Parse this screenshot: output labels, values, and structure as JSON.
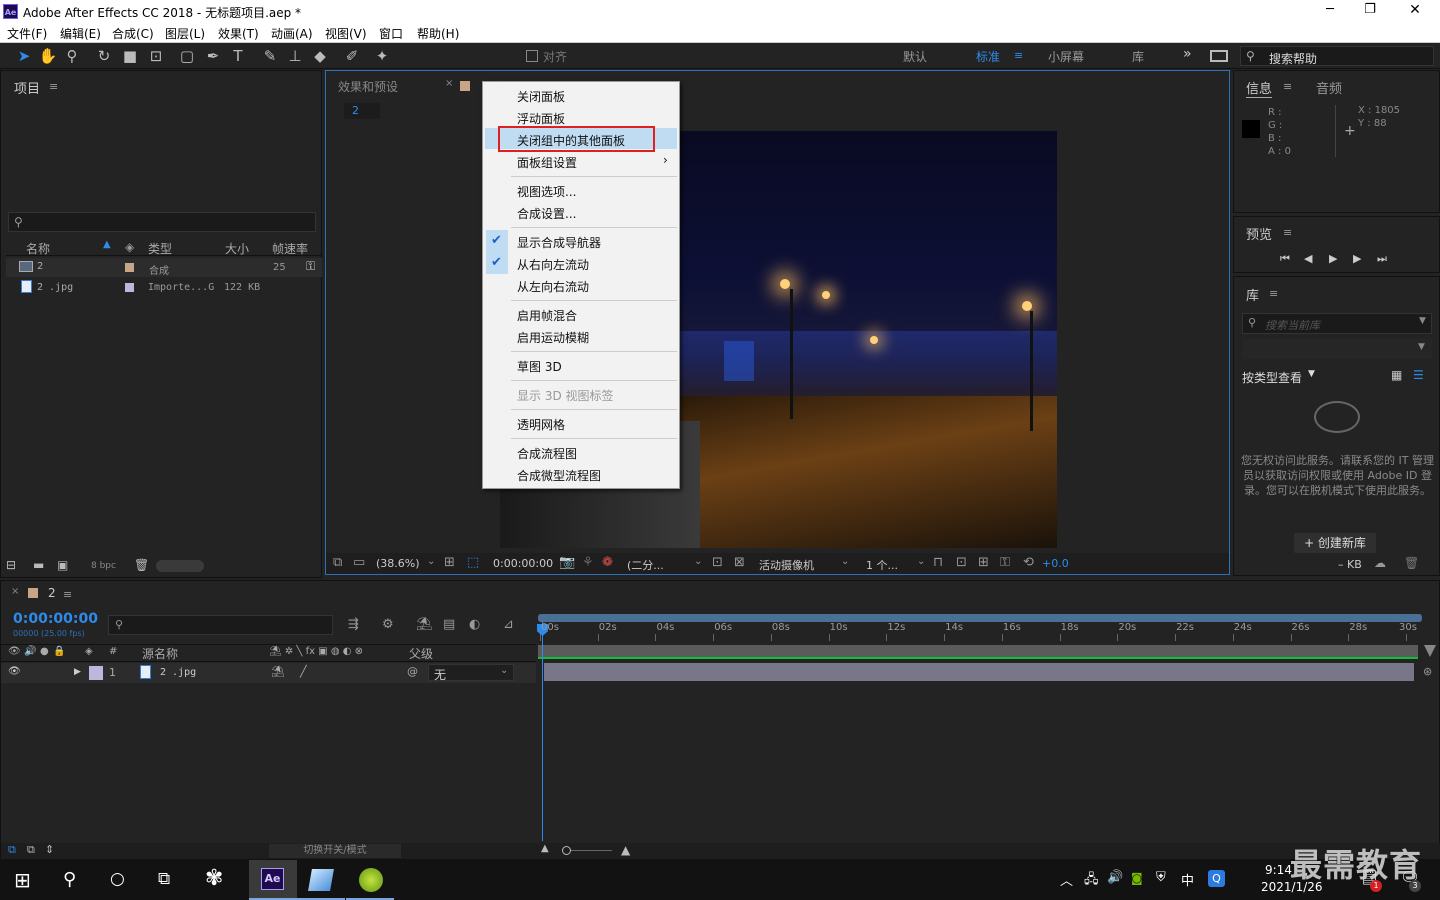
{
  "window": {
    "title": "Adobe After Effects CC 2018 - 无标题项目.aep *",
    "app_badge": "Ae",
    "min": "─",
    "max": "❐",
    "close": "✕"
  },
  "menubar": [
    "文件(F)",
    "编辑(E)",
    "合成(C)",
    "图层(L)",
    "效果(T)",
    "动画(A)",
    "视图(V)",
    "窗口",
    "帮助(H)"
  ],
  "toolbar": {
    "snap_label": "对齐",
    "workspaces": [
      "默认",
      "标准",
      "小屏幕",
      "库"
    ],
    "active_workspace": "标准",
    "more": "»",
    "search_help": "搜索帮助"
  },
  "project_panel": {
    "title": "项目",
    "columns": [
      "名称",
      "类型",
      "大小",
      "帧速率"
    ],
    "rows": [
      {
        "name": "2",
        "type": "合成",
        "size": "",
        "fps": "25"
      },
      {
        "name": "2 .jpg",
        "type": "Importe...G",
        "size": "122 KB",
        "fps": ""
      }
    ],
    "bpc": "8 bpc"
  },
  "comp_panel": {
    "tab_effects": "效果和预设",
    "tab_comp_partial": "合成",
    "breadcrumb": "2",
    "zoom": "(38.6%)",
    "timecode": "0:00:00:00",
    "resolution": "(二分...",
    "camera": "活动摄像机",
    "views": "1 个...",
    "exposure": "+0.0"
  },
  "context_menu": {
    "items": [
      {
        "label": "关闭面板",
        "checked": false,
        "disabled": false
      },
      {
        "label": "浮动面板",
        "checked": false,
        "disabled": false
      },
      {
        "label": "关闭组中的其他面板",
        "checked": false,
        "disabled": false,
        "highlighted": true
      },
      {
        "label": "面板组设置",
        "checked": false,
        "disabled": false,
        "submenu": true
      },
      {
        "label": "视图选项...",
        "checked": false,
        "disabled": false
      },
      {
        "label": "合成设置...",
        "checked": false,
        "disabled": false
      },
      {
        "label": "显示合成导航器",
        "checked": true,
        "disabled": false
      },
      {
        "label": "从右向左流动",
        "checked": true,
        "disabled": false
      },
      {
        "label": "从左向右流动",
        "checked": false,
        "disabled": false
      },
      {
        "label": "启用帧混合",
        "checked": false,
        "disabled": false
      },
      {
        "label": "启用运动模糊",
        "checked": false,
        "disabled": false
      },
      {
        "label": "草图 3D",
        "checked": false,
        "disabled": false
      },
      {
        "label": "显示 3D 视图标签",
        "checked": false,
        "disabled": true
      },
      {
        "label": "透明网格",
        "checked": false,
        "disabled": false
      },
      {
        "label": "合成流程图",
        "checked": false,
        "disabled": false
      },
      {
        "label": "合成微型流程图",
        "checked": false,
        "disabled": false
      }
    ],
    "highlight_color": "#c0dcf3",
    "outline_color": "#e02020"
  },
  "info_panel": {
    "tab_info": "信息",
    "tab_audio": "音频",
    "r": "R :",
    "g": "G :",
    "b": "B :",
    "a": "A : 0",
    "x": "X : 1805",
    "y": "Y : 88"
  },
  "preview_panel": {
    "title": "预览"
  },
  "library_panel": {
    "title": "库",
    "search_placeholder": "搜索当前库",
    "view_by": "按类型查看",
    "message": "您无权访问此服务。请联系您的 IT 管理员以获取访问权限或使用 Adobe ID 登录。您可以在脱机模式下使用此服务。",
    "create_button": "+ 创建新库",
    "size": "– KB"
  },
  "timeline": {
    "tab_name": "2",
    "timecode": "0:00:00:00",
    "timecode_sub": "00000 (25.00 fps)",
    "col_source": "源名称",
    "col_parent": "父级",
    "layer": {
      "index": "1",
      "name": "2 .jpg",
      "parent": "无"
    },
    "ticks": [
      "00s",
      "02s",
      "04s",
      "06s",
      "08s",
      "10s",
      "12s",
      "14s",
      "16s",
      "18s",
      "20s",
      "22s",
      "24s",
      "26s",
      "28s",
      "30s"
    ],
    "mode_toggle": "切换开关/模式"
  },
  "taskbar": {
    "time": "9:14",
    "date": "2021/1/26",
    "ime": "中",
    "notif_count": "3",
    "badge": "1",
    "watermark": "最需教育"
  },
  "colors": {
    "accent_blue": "#2d8ceb",
    "panel_bg": "#232323",
    "timeline_green": "#0fbf3a",
    "layer_bar": "#7a7689"
  }
}
